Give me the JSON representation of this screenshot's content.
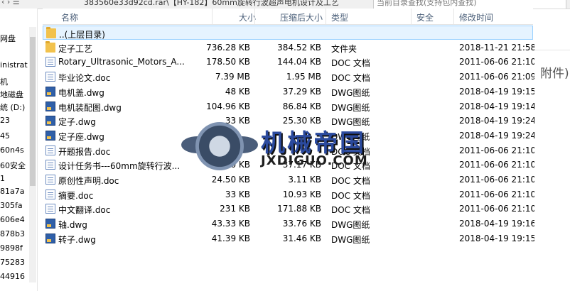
{
  "top": {
    "crumb": "383560e33d92cd.rar\\【HY-182】60mm旋转行波超声电机设计及工艺",
    "search_placeholder": "当前目录查找(支持包内查找)"
  },
  "nav": [
    "网盘",
    "inistrat",
    "机",
    "地磁盘",
    "统 (D:)",
    "23",
    "45",
    "60n4s",
    "60安全",
    "1",
    "81a7a",
    "305fa",
    "606e4",
    "878b3",
    "9898f",
    "75283",
    "44916"
  ],
  "columns": [
    "名称",
    "大小",
    "压缩后大小",
    "类型",
    "安全",
    "修改时间"
  ],
  "files": [
    {
      "name": "..(上层目录)",
      "size": "",
      "packed": "",
      "type": "",
      "date": "",
      "icon": "folder"
    },
    {
      "name": "定子工艺",
      "size": "736.28 KB",
      "packed": "384.52 KB",
      "type": "文件夹",
      "date": "2018-11-21 21:58",
      "icon": "folder"
    },
    {
      "name": "Rotary_Ultrasonic_Motors_A...",
      "size": "178.50 KB",
      "packed": "144.04 KB",
      "type": "DOC 文档",
      "date": "2011-06-06 21:10",
      "icon": "doc"
    },
    {
      "name": "毕业论文.doc",
      "size": "7.39 MB",
      "packed": "1.95 MB",
      "type": "DOC 文档",
      "date": "2011-06-06 21:09",
      "icon": "doc"
    },
    {
      "name": "电机盖.dwg",
      "size": "48 KB",
      "packed": "37.29 KB",
      "type": "DWG图纸",
      "date": "2018-04-19 19:15",
      "icon": "dwg"
    },
    {
      "name": "电机装配图.dwg",
      "size": "104.96 KB",
      "packed": "86.84 KB",
      "type": "DWG图纸",
      "date": "2018-04-19 19:14",
      "icon": "dwg"
    },
    {
      "name": "定子.dwg",
      "size": "33 KB",
      "packed": "25.30 KB",
      "type": "DWG图纸",
      "date": "2018-04-19 19:24",
      "icon": "dwg"
    },
    {
      "name": "定子座.dwg",
      "size": "",
      "packed": "",
      "type": "DWG图纸",
      "date": "2018-04-19 19:24",
      "icon": "dwg"
    },
    {
      "name": "开题报告.doc",
      "size": "",
      "packed": "",
      "type": "DOC 文档",
      "date": "2011-06-06 21:10",
      "icon": "doc"
    },
    {
      "name": "设计任务书---60mm旋转行波...",
      "size": "76.50 KB",
      "packed": "37.17 KB",
      "type": "DOC 文档",
      "date": "2011-06-06 21:10",
      "icon": "doc"
    },
    {
      "name": "原创性声明.doc",
      "size": "24.50 KB",
      "packed": "3.11 KB",
      "type": "DOC 文档",
      "date": "2011-06-06 21:10",
      "icon": "doc"
    },
    {
      "name": "摘要.doc",
      "size": "33 KB",
      "packed": "10.93 KB",
      "type": "DOC 文档",
      "date": "2011-06-06 21:10",
      "icon": "doc"
    },
    {
      "name": "中文翻译.doc",
      "size": "231 KB",
      "packed": "171.88 KB",
      "type": "DOC 文档",
      "date": "2011-06-06 21:10",
      "icon": "doc"
    },
    {
      "name": "轴.dwg",
      "size": "43.33 KB",
      "packed": "33.76 KB",
      "type": "DWG图纸",
      "date": "2018-04-19 19:16",
      "icon": "dwg"
    },
    {
      "name": "转子.dwg",
      "size": "41.39 KB",
      "packed": "31.46 KB",
      "type": "DWG图纸",
      "date": "2018-04-19 19:15",
      "icon": "dwg"
    }
  ],
  "right_text": "附件)",
  "watermark": {
    "title": "机械帝国",
    "url": "JXDIGUO.COM"
  }
}
